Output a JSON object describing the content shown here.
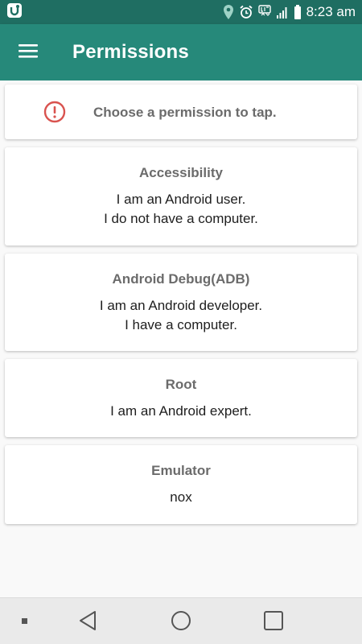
{
  "status_bar": {
    "time": "8:23 am",
    "icons": [
      "app-notification-icon",
      "location-icon",
      "alarm-icon",
      "lte-icon",
      "signal-icon",
      "battery-icon"
    ]
  },
  "app_bar": {
    "title": "Permissions",
    "background": "#26897a",
    "status_background": "#1f6e62"
  },
  "info_card": {
    "icon": "info-icon",
    "text": "Choose a permission to tap.",
    "icon_color": "#d9534f"
  },
  "permissions": [
    {
      "title": "Accessibility",
      "lines": [
        "I am an Android user.",
        "I do not have a computer."
      ]
    },
    {
      "title": "Android Debug(ADB)",
      "lines": [
        "I am an Android developer.",
        "I have a computer."
      ]
    },
    {
      "title": "Root",
      "lines": [
        "I am an Android expert."
      ]
    },
    {
      "title": "Emulator",
      "lines": [
        "nox"
      ]
    }
  ],
  "nav_bar": {
    "items": [
      "dot-icon",
      "back-icon",
      "home-icon",
      "recents-icon"
    ]
  }
}
